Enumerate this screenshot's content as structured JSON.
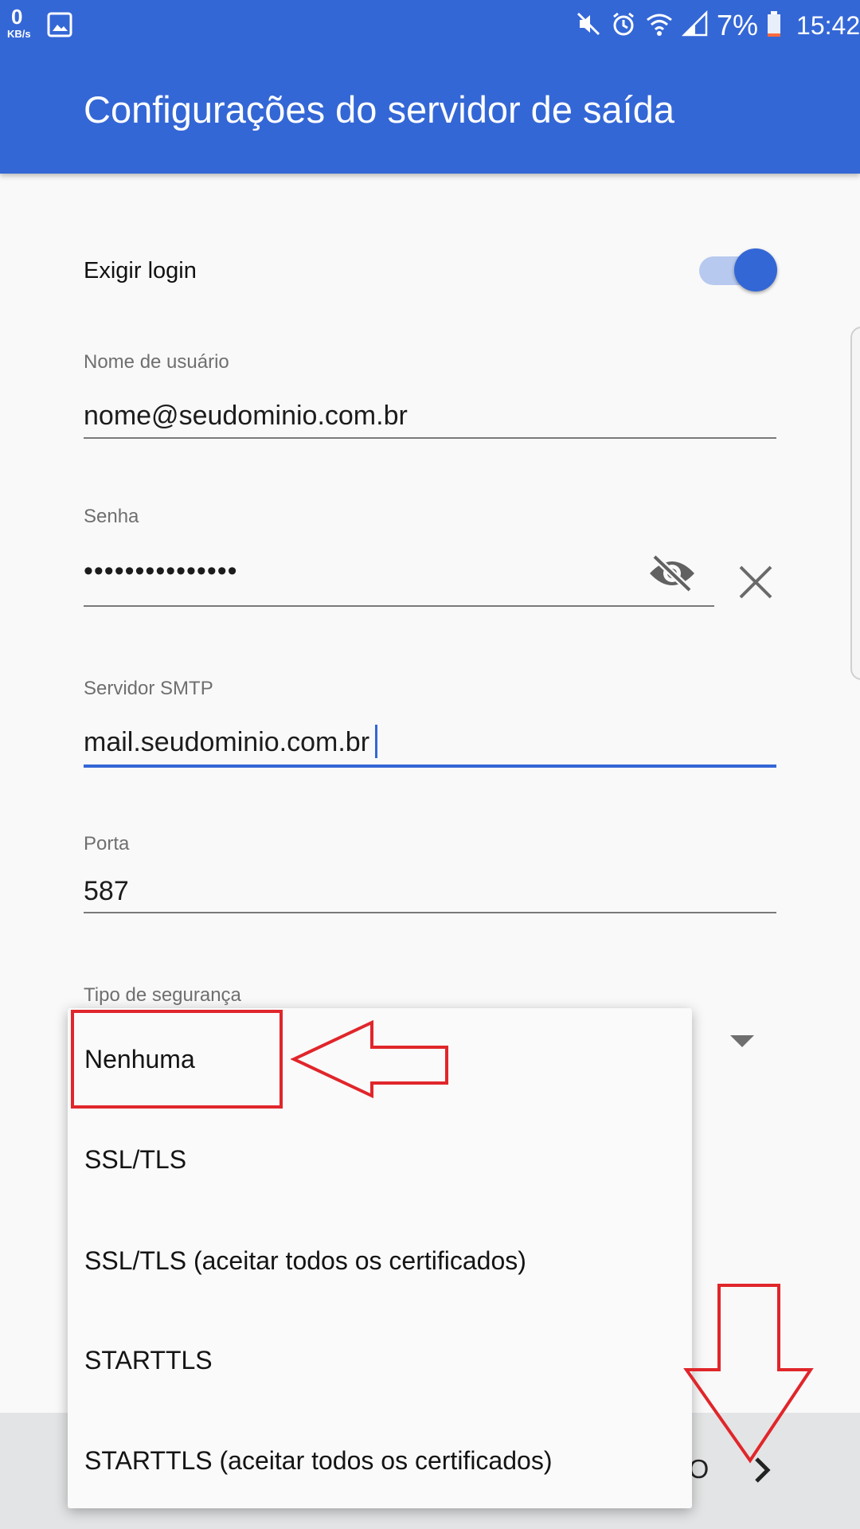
{
  "status_bar": {
    "net_speed": "0",
    "net_speed_unit": "KB/s",
    "battery_percent": "7%",
    "time": "15:42",
    "icons": [
      "gallery-icon",
      "mute-icon",
      "alarm-icon",
      "wifi-icon",
      "signal-icon",
      "battery-icon"
    ]
  },
  "header": {
    "title": "Configurações do servidor de saída"
  },
  "form": {
    "require_login": {
      "label": "Exigir login",
      "enabled": true
    },
    "username": {
      "label": "Nome de usuário",
      "value": "nome@seudominio.com.br"
    },
    "password": {
      "label": "Senha",
      "value": "•••••••••••••••"
    },
    "smtp_server": {
      "label": "Servidor SMTP",
      "value": "mail.seudominio.com.br"
    },
    "port": {
      "label": "Porta",
      "value": "587"
    },
    "security_type": {
      "label": "Tipo de segurança"
    }
  },
  "dropdown": {
    "options": [
      "Nenhuma",
      "SSL/TLS",
      "SSL/TLS (aceitar todos os certificados)",
      "STARTTLS",
      "STARTTLS (aceitar todos os certificados)"
    ],
    "highlighted_option": "Nenhuma"
  },
  "bottom_bar": {
    "next_label": "IMO"
  },
  "colors": {
    "primary": "#3467d6",
    "annotation": "#e0262b",
    "background": "#f9f9f9"
  }
}
